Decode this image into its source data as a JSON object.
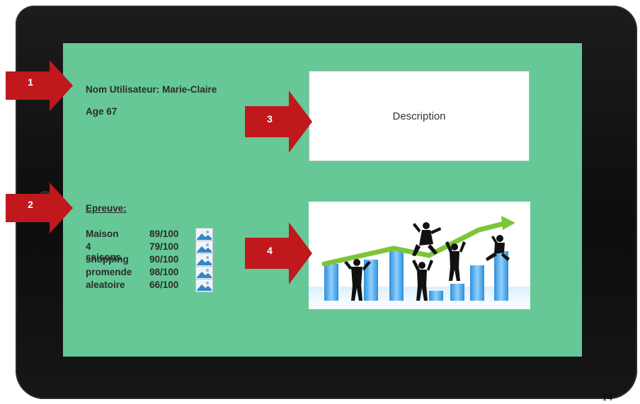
{
  "user": {
    "name_line": "Nom Utilisateur:  Marie-Claire",
    "age_line": "Age 67"
  },
  "description": {
    "label": "Description"
  },
  "epreuve": {
    "title": "Epreuve:",
    "items": [
      {
        "name": "Maison",
        "score": "89/100"
      },
      {
        "name": "4 saisons",
        "score": "79/100"
      },
      {
        "name": "shopping",
        "score": "90/100"
      },
      {
        "name": "promende",
        "score": "98/100"
      },
      {
        "name": "aleatoire",
        "score": "66/100"
      }
    ]
  },
  "markers": [
    "1",
    "2",
    "3",
    "4"
  ],
  "corner_text": "14",
  "colors": {
    "screen_bg": "#66c897",
    "arrow_red": "#c0181c",
    "bezel": "#111111"
  },
  "icons": [
    "image-placeholder-icon",
    "growth-chart-illustration-icon"
  ]
}
